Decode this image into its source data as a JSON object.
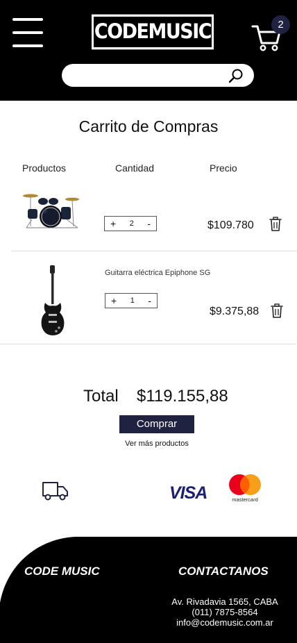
{
  "header": {
    "logo": "CODEMUSIC",
    "cart_count": "2",
    "search": {
      "value": "",
      "placeholder": ""
    }
  },
  "cart": {
    "title": "Carrito de Compras",
    "columns": [
      "Productos",
      "Cantidad",
      "Precio"
    ],
    "items": [
      {
        "name": "",
        "image": "drum-kit",
        "quantity": "2",
        "price": "$109.780"
      },
      {
        "name": "Guitarra eléctrica Epiphone SG",
        "image": "electric-guitar",
        "quantity": "1",
        "price": "$9.375,88"
      }
    ],
    "qty_plus": "+",
    "qty_minus": "-"
  },
  "summary": {
    "total_label": "Total",
    "total_value": "$119.155,88",
    "buy_label": "Comprar",
    "more_label": "Ver más productos"
  },
  "payments": {
    "shipping_icon": "truck-icon",
    "visa_label": "VISA",
    "mastercard_label": "mastercard"
  },
  "footer": {
    "brand": "CODE MUSIC",
    "contact_title": "CONTACTANOS",
    "address": "Av. Rivadavia 1565, CABA",
    "phone": "(011) 7875-8564",
    "email": "info@codemusic.com.ar"
  },
  "colors": {
    "header_bg": "#000000",
    "accent": "#1f2241",
    "footer_bg": "#000000"
  }
}
